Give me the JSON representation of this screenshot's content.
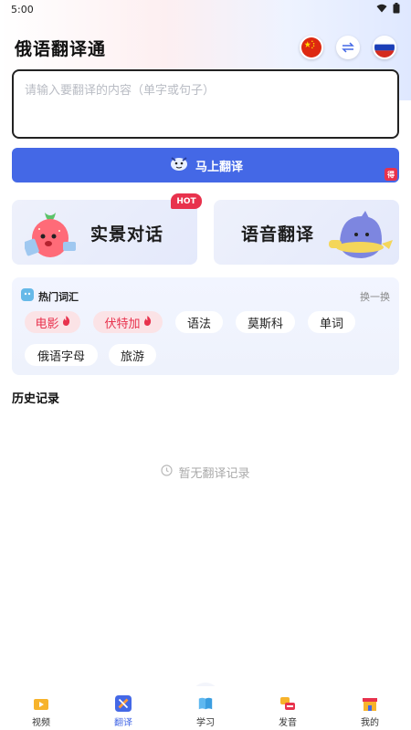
{
  "status": {
    "time": "5:00"
  },
  "header": {
    "title": "俄语翻译通",
    "source_lang_icon": "china-flag-icon",
    "target_lang_icon": "russia-flag-icon",
    "swap_icon": "swap-arrows-icon"
  },
  "input": {
    "placeholder": "请输入要翻译的内容（单字或句子）",
    "value": ""
  },
  "translate_button": {
    "label": "马上翻译",
    "badge": "得"
  },
  "features": [
    {
      "label": "实景对话",
      "badge": "HOT"
    },
    {
      "label": "语音翻译"
    }
  ],
  "hotwords": {
    "title": "热门词汇",
    "refresh": "换一换",
    "chips": [
      {
        "label": "电影",
        "hot": true
      },
      {
        "label": "伏特加",
        "hot": true
      },
      {
        "label": "语法",
        "hot": false
      },
      {
        "label": "莫斯科",
        "hot": false
      },
      {
        "label": "单词",
        "hot": false
      },
      {
        "label": "俄语字母",
        "hot": false
      },
      {
        "label": "旅游",
        "hot": false
      }
    ]
  },
  "history": {
    "title": "历史记录",
    "empty_text": "暂无翻译记录"
  },
  "tabbar": {
    "active_index": 1,
    "tabs": [
      {
        "label": "视频",
        "icon": "video-icon"
      },
      {
        "label": "翻译",
        "icon": "translate-icon"
      },
      {
        "label": "学习",
        "icon": "book-icon"
      },
      {
        "label": "发音",
        "icon": "pronunciation-icon"
      },
      {
        "label": "我的",
        "icon": "profile-icon"
      }
    ]
  },
  "colors": {
    "accent": "#4468e6",
    "hot": "#e8324d"
  }
}
